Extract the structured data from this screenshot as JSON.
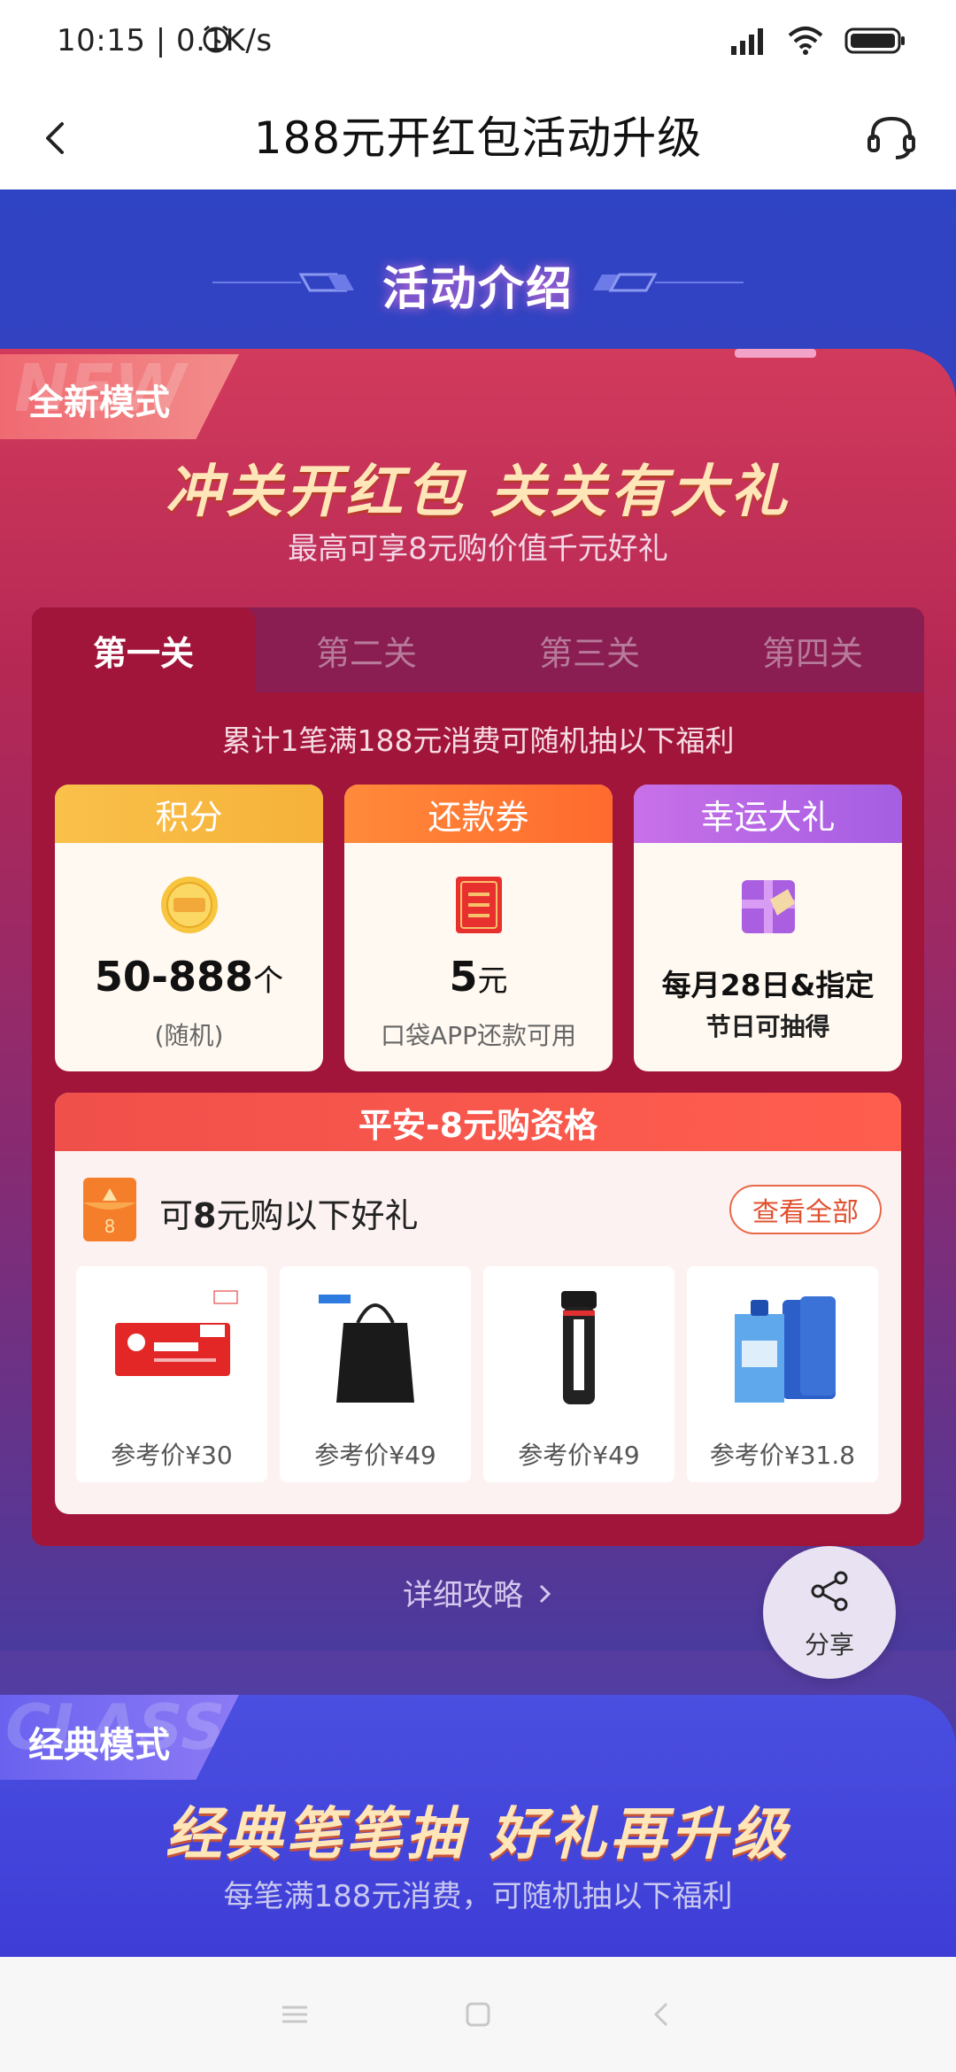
{
  "status_bar": {
    "time": "10:15 | 0.1K/s"
  },
  "nav": {
    "title": "188元开红包活动升级"
  },
  "intro": {
    "title": "活动介绍"
  },
  "new_mode": {
    "bg_text": "NEW",
    "tag": "全新模式",
    "slogan": "冲关开红包 关关有大礼",
    "subtitle": "最高可享8元购价值千元好礼",
    "tabs": [
      "第一关",
      "第二关",
      "第三关",
      "第四关"
    ],
    "active_tab": 0,
    "description": "累计1笔满188元消费可随机抽以下福利",
    "prizes": [
      {
        "title": "积分",
        "main": "50-888",
        "unit": "个",
        "sub": "(随机)"
      },
      {
        "title": "还款券",
        "main": "5",
        "unit": "元",
        "sub": "口袋APP还款可用"
      },
      {
        "title": "幸运大礼",
        "main": "每月28日&指定",
        "unit": "",
        "sub": "节日可抽得"
      }
    ],
    "eight_yuan": {
      "title": "平安-8元购资格",
      "label_prefix": "可",
      "label_bold": "8",
      "label_suffix": "元购以下好礼",
      "view_all": "查看全部",
      "gifts": [
        {
          "price": "参考价¥30"
        },
        {
          "price": "参考价¥49"
        },
        {
          "price": "参考价¥49"
        },
        {
          "price": "参考价¥31.8"
        }
      ]
    },
    "detail_link": "详细攻略"
  },
  "share": {
    "label": "分享"
  },
  "classic_mode": {
    "bg_text": "CLASSIC",
    "tag": "经典模式",
    "slogan": "经典笔笔抽 好礼再升级",
    "subtitle": "每笔满188元消费，可随机抽以下福利"
  },
  "colors": {
    "brand_red": "#a1153a",
    "hero_blue": "#2f44c4",
    "accent_orange": "#e0502f"
  }
}
